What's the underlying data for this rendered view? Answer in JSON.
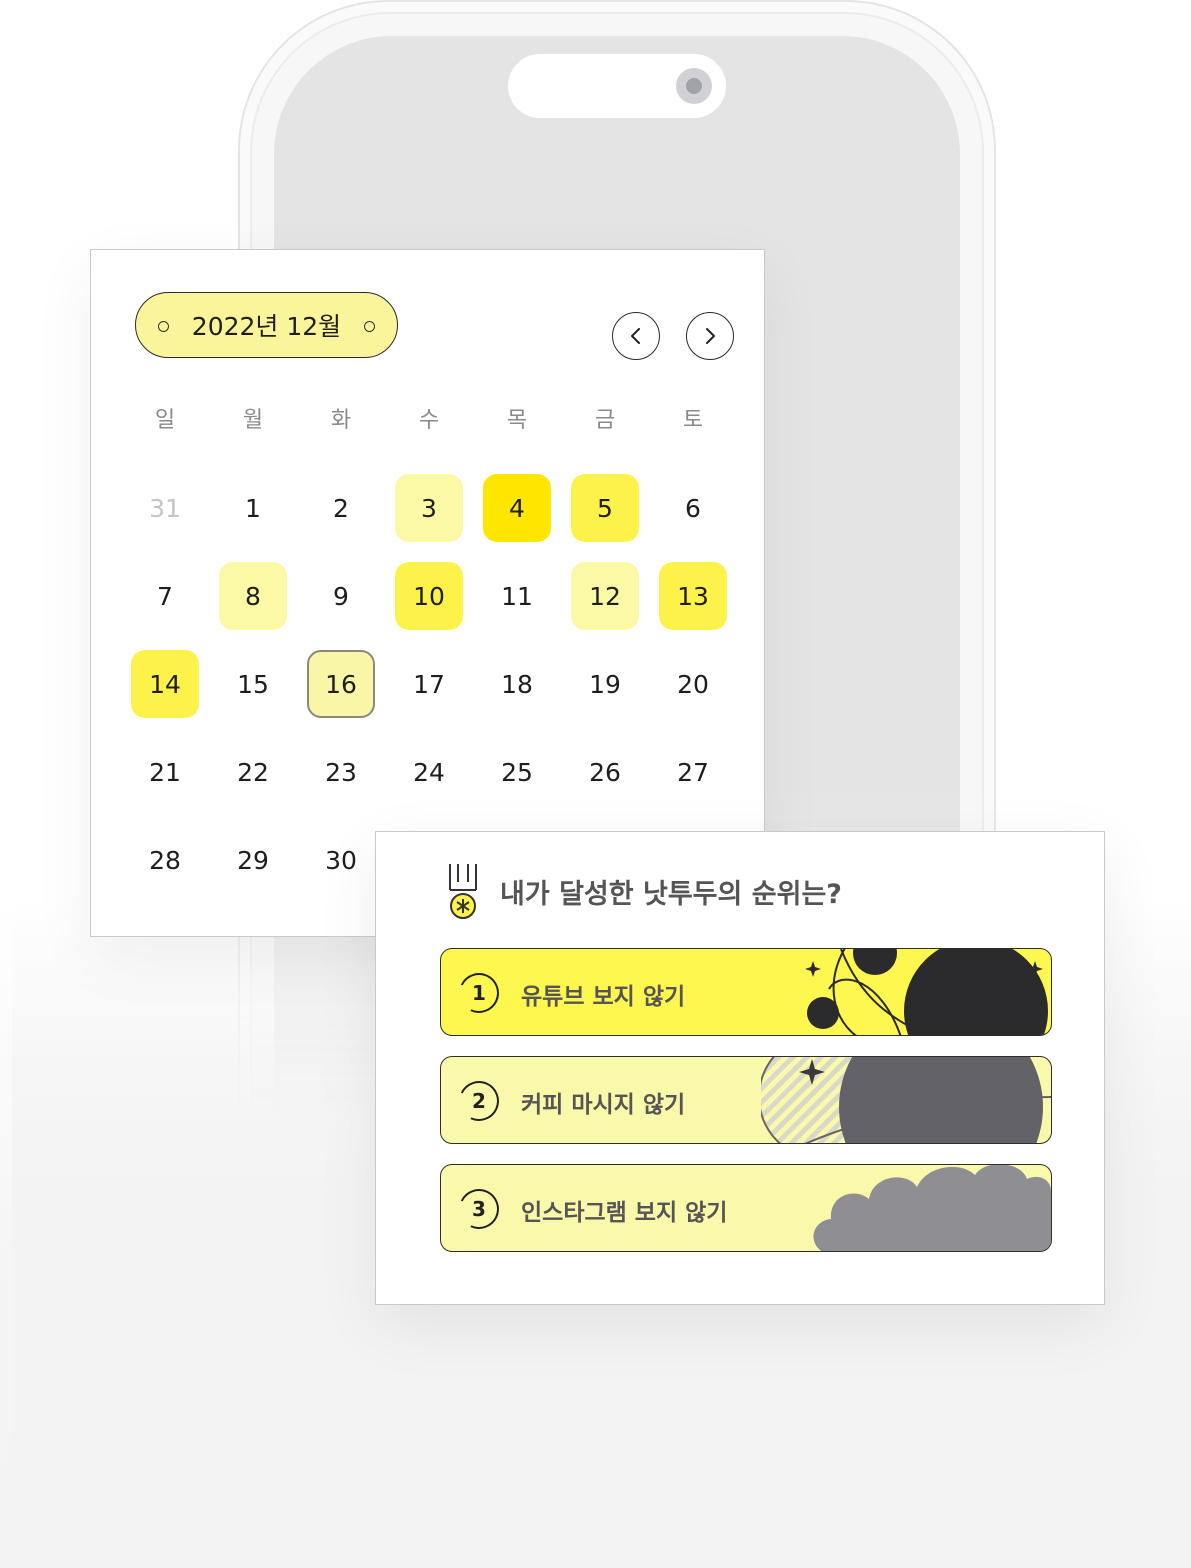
{
  "calendar": {
    "month_label": "2022년 12월",
    "weekdays": [
      "일",
      "월",
      "화",
      "수",
      "목",
      "금",
      "토"
    ],
    "weeks": [
      [
        "31",
        "1",
        "2",
        "3",
        "4",
        "5",
        "6"
      ],
      [
        "7",
        "8",
        "9",
        "10",
        "11",
        "12",
        "13"
      ],
      [
        "14",
        "15",
        "16",
        "17",
        "18",
        "19",
        "20"
      ],
      [
        "21",
        "22",
        "23",
        "24",
        "25",
        "26",
        "27"
      ],
      [
        "28",
        "29",
        "30"
      ]
    ]
  },
  "ranking": {
    "title": "내가 달성한 낫투두의 순위는?",
    "items": [
      {
        "rank": "1",
        "label": "유튜브 보지 않기"
      },
      {
        "rank": "2",
        "label": "커피 마시지 않기"
      },
      {
        "rank": "3",
        "label": "인스타그램 보지 않기"
      }
    ]
  },
  "colors": {
    "highlight_light": "#fbf8a6",
    "highlight_mid": "#fdf24a",
    "highlight_strong": "#fee600"
  },
  "icons": [
    "chevron-left-icon",
    "chevron-right-icon",
    "medal-icon"
  ]
}
